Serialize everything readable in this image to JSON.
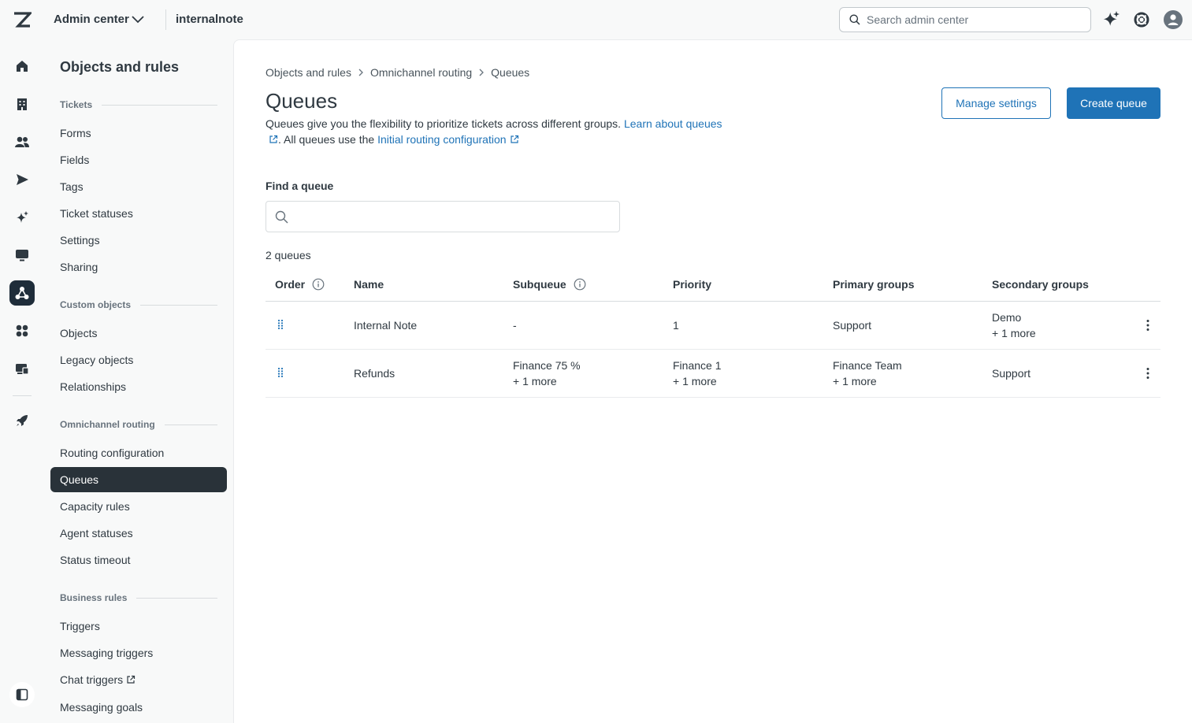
{
  "topbar": {
    "product": "Admin center",
    "account": "internalnote",
    "search_placeholder": "Search admin center"
  },
  "nav": {
    "title": "Objects and rules",
    "sections": {
      "tickets": "Tickets",
      "custom_objects": "Custom objects",
      "omnichannel": "Omnichannel routing",
      "business_rules": "Business rules"
    },
    "tickets_items": [
      "Forms",
      "Fields",
      "Tags",
      "Ticket statuses",
      "Settings",
      "Sharing"
    ],
    "custom_items": [
      "Objects",
      "Legacy objects",
      "Relationships"
    ],
    "omni_items": [
      "Routing configuration",
      "Queues",
      "Capacity rules",
      "Agent statuses",
      "Status timeout"
    ],
    "business_items": [
      "Triggers",
      "Messaging triggers",
      "Chat triggers",
      "Messaging goals"
    ]
  },
  "breadcrumb": [
    "Objects and rules",
    "Omnichannel routing",
    "Queues"
  ],
  "page": {
    "title": "Queues",
    "desc_1": "Queues give you the flexibility to prioritize tickets across different groups. ",
    "desc_link_1": "Learn about queues",
    "desc_2": ". All queues use the ",
    "desc_link_2": "Initial routing configuration",
    "manage_button": "Manage settings",
    "create_button": "Create queue",
    "find_label": "Find a queue",
    "find_placeholder": "",
    "count": "2 queues"
  },
  "table": {
    "headers": [
      "Order",
      "Name",
      "Subqueue",
      "Priority",
      "Primary groups",
      "Secondary groups"
    ],
    "rows": [
      {
        "name": "Internal Note",
        "subqueue": "-",
        "subqueue_more": "",
        "priority": "1",
        "priority_more": "",
        "primary": "Support",
        "primary_more": "",
        "secondary": "Demo",
        "secondary_more": "+ 1 more"
      },
      {
        "name": "Refunds",
        "subqueue": "Finance 75 %",
        "subqueue_more": "+ 1 more",
        "priority": "Finance 1",
        "priority_more": "+ 1 more",
        "primary": "Finance Team",
        "primary_more": "+ 1 more",
        "secondary": "Support",
        "secondary_more": ""
      }
    ]
  },
  "colors": {
    "accent": "#1f73b7",
    "active_nav": "#293239",
    "text": "#2f3941"
  },
  "icons": [
    "zendesk-logo-icon",
    "chevron-down-icon",
    "search-icon",
    "sparkle-icon",
    "help-icon",
    "avatar-icon",
    "home-icon",
    "building-icon",
    "people-icon",
    "send-icon",
    "ai-sparkle-icon",
    "monitor-icon",
    "objects-rules-icon",
    "apps-icon",
    "workspace-icon",
    "rocket-icon",
    "sidebar-toggle-icon",
    "info-icon",
    "drag-handle-icon",
    "more-options-icon",
    "external-link-icon"
  ]
}
